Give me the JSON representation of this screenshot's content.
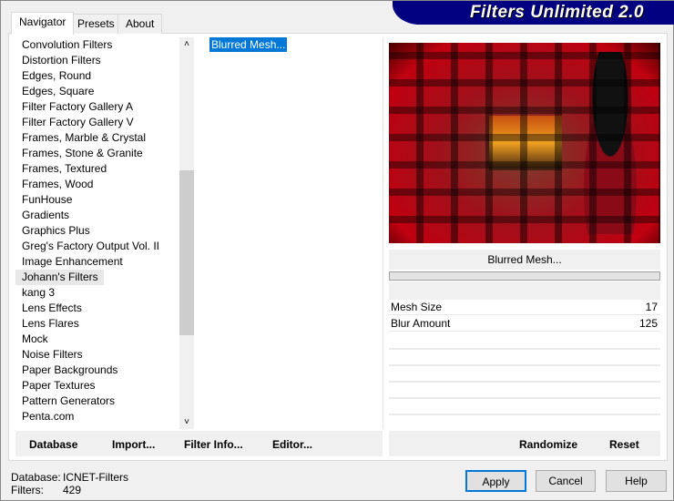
{
  "title": "Filters Unlimited 2.0",
  "tabs": [
    "Navigator",
    "Presets",
    "About"
  ],
  "categories": [
    "Convolution Filters",
    "Distortion Filters",
    "Edges, Round",
    "Edges, Square",
    "Filter Factory Gallery A",
    "Filter Factory Gallery V",
    "Frames, Marble & Crystal",
    "Frames, Stone & Granite",
    "Frames, Textured",
    "Frames, Wood",
    "FunHouse",
    "Gradients",
    "Graphics Plus",
    "Greg's Factory Output Vol. II",
    "Image Enhancement",
    "Johann's Filters",
    "kang 3",
    "Lens Effects",
    "Lens Flares",
    "Mock",
    "Noise Filters",
    "Paper Backgrounds",
    "Paper Textures",
    "Pattern Generators",
    "Penta.com"
  ],
  "selected_category": "Johann's Filters",
  "filters": [
    "Blurred Mesh..."
  ],
  "filter_name": "Blurred Mesh...",
  "params": [
    {
      "label": "Mesh Size",
      "value": "17"
    },
    {
      "label": "Blur Amount",
      "value": "125"
    }
  ],
  "left_buttons": [
    "Database",
    "Import...",
    "Filter Info...",
    "Editor..."
  ],
  "right_buttons": [
    "Randomize",
    "Reset"
  ],
  "status": {
    "db_label": "Database:",
    "db_value": "ICNET-Filters",
    "count_label": "Filters:",
    "count_value": "429"
  },
  "dialog_buttons": [
    "Apply",
    "Cancel",
    "Help"
  ],
  "colors": {
    "banner": "#000080",
    "selection": "#0078d7",
    "apply_border": "#0078d7"
  }
}
